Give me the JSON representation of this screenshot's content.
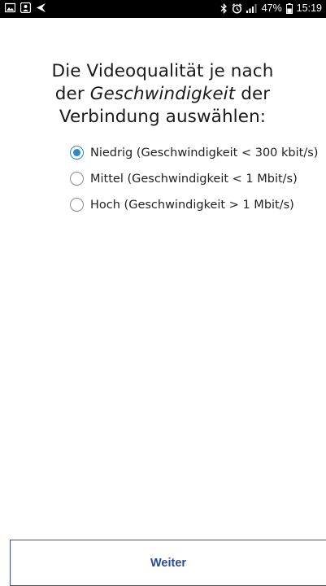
{
  "statusbar": {
    "battery_percent": "47%",
    "time": "15:19",
    "icons": [
      "gallery-icon",
      "contact-icon",
      "send-icon",
      "bluetooth-icon",
      "alarm-icon",
      "signal-icon",
      "battery-icon"
    ]
  },
  "question": {
    "line1": "Die Videoqualität je nach",
    "line2_prefix": "der ",
    "line2_em": "Geschwindigkeit",
    "line2_suffix": " der",
    "line3": "Verbindung auswählen:"
  },
  "options": [
    {
      "label": "Niedrig (Geschwindigkeit < 300 kbit/s)",
      "checked": true
    },
    {
      "label": "Mittel (Geschwindigkeit < 1 Mbit/s)",
      "checked": false
    },
    {
      "label": "Hoch (Geschwindigkeit > 1 Mbit/s)",
      "checked": false
    }
  ],
  "footer": {
    "next_label": "Weiter"
  },
  "colors": {
    "accent": "#2f86cc",
    "button_text": "#2b4a9a",
    "button_border": "#3a4f93",
    "statusbar_bg": "#000000"
  }
}
